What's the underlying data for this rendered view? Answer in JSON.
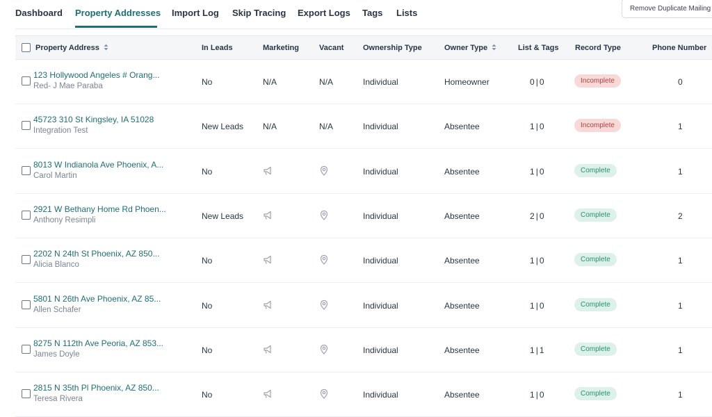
{
  "nav": {
    "tabs": [
      {
        "label": "Dashboard"
      },
      {
        "label": "Property Addresses",
        "active": true
      },
      {
        "label": "Import Log"
      },
      {
        "label": "Skip Tracing"
      },
      {
        "label": "Export Logs"
      },
      {
        "label": "Tags"
      },
      {
        "label": "Lists"
      }
    ],
    "remove_button": "Remove Duplicate Mailing"
  },
  "table": {
    "headers": {
      "property_address": "Property Address",
      "in_leads": "In Leads",
      "marketing": "Marketing",
      "vacant": "Vacant",
      "ownership_type": "Ownership Type",
      "owner_type": "Owner Type",
      "list_tags": "List & Tags",
      "record_type": "Record Type",
      "phone_number": "Phone Number"
    },
    "rows": [
      {
        "address": "123 Hollywood Angeles # Orang...",
        "owner": "Red- J Mae Paraba",
        "in_leads": "No",
        "marketing": "N/A",
        "vacant": "N/A",
        "ownership_type": "Individual",
        "owner_type": "Homeowner",
        "lists": "0",
        "tags": "0",
        "record_type": "Incomplete",
        "phone": "0"
      },
      {
        "address": "45723 310 St Kingsley, IA 51028",
        "owner": "Integration Test",
        "in_leads": "New Leads",
        "marketing": "N/A",
        "vacant": "N/A",
        "ownership_type": "Individual",
        "owner_type": "Absentee",
        "lists": "1",
        "tags": "0",
        "record_type": "Incomplete",
        "phone": "1"
      },
      {
        "address": "8013 W Indianola Ave Phoenix, A...",
        "owner": "Carol Martin",
        "in_leads": "No",
        "marketing": "",
        "vacant": "",
        "ownership_type": "Individual",
        "owner_type": "Absentee",
        "lists": "1",
        "tags": "0",
        "record_type": "Complete",
        "phone": "1"
      },
      {
        "address": "2921 W Bethany Home Rd Phoen...",
        "owner": "Anthony Resimpli",
        "in_leads": "New Leads",
        "marketing": "",
        "vacant": "",
        "ownership_type": "Individual",
        "owner_type": "Absentee",
        "lists": "2",
        "tags": "0",
        "record_type": "Complete",
        "phone": "2"
      },
      {
        "address": "2202 N 24th St Phoenix, AZ 850...",
        "owner": "Alicia Blanco",
        "in_leads": "No",
        "marketing": "",
        "vacant": "",
        "ownership_type": "Individual",
        "owner_type": "Absentee",
        "lists": "1",
        "tags": "0",
        "record_type": "Complete",
        "phone": "1"
      },
      {
        "address": "5801 N 26th Ave Phoenix, AZ 85...",
        "owner": "Allen Schafer",
        "in_leads": "No",
        "marketing": "",
        "vacant": "",
        "ownership_type": "Individual",
        "owner_type": "Absentee",
        "lists": "1",
        "tags": "0",
        "record_type": "Complete",
        "phone": "1"
      },
      {
        "address": "8275 N 112th Ave Peoria, AZ 853...",
        "owner": "James Doyle",
        "in_leads": "No",
        "marketing": "",
        "vacant": "",
        "ownership_type": "Individual",
        "owner_type": "Absentee",
        "lists": "1",
        "tags": "1",
        "record_type": "Complete",
        "phone": "1"
      },
      {
        "address": "2815 N 35th Pl Phoenix, AZ 850...",
        "owner": "Teresa Rivera",
        "in_leads": "No",
        "marketing": "",
        "vacant": "",
        "ownership_type": "Individual",
        "owner_type": "Absentee",
        "lists": "1",
        "tags": "0",
        "record_type": "Complete",
        "phone": "1"
      }
    ]
  },
  "icons": {
    "marketing": "megaphone-icon",
    "vacant": "location-pin-icon",
    "sort": "sort-arrows-icon"
  },
  "colors": {
    "accent": "#1e6f74",
    "incomplete_bg": "#f9d8d8",
    "incomplete_text": "#b0413e",
    "complete_bg": "#dcf1ea",
    "complete_text": "#2f8f6f"
  }
}
